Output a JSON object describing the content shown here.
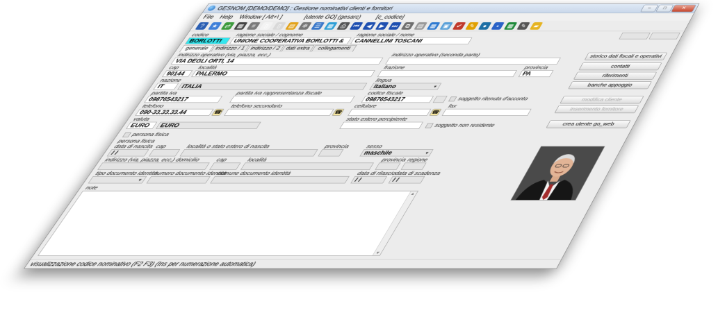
{
  "window": {
    "title": "GESNOM [DEMO/DEMO] : Gestione nominativi clienti e fornitori",
    "minimize_label": "–",
    "maximize_label": "□",
    "close_label": "✕"
  },
  "menu": {
    "file": "File",
    "help": "Help",
    "window": "Window [ Alt+\\ ]",
    "user": "[utente GO] (gesarc)",
    "field": "[c_codice]"
  },
  "toolbar": {
    "icons": [
      "help-icon",
      "star-icon",
      "export-icon",
      "calculator-icon",
      "notes-icon",
      "document-icon",
      "new-page-icon",
      "print-folder-icon",
      "gear-icon",
      "list-icon",
      "calendar-icon",
      "printer-icon",
      "first-record-icon",
      "prev-record-icon",
      "next-record-icon",
      "last-record-icon",
      "copy-icon",
      "notepad-icon",
      "calculator2-icon",
      "image-icon",
      "check-icon",
      "tools-icon",
      "globe-icon",
      "save-icon",
      "export-excel-icon",
      "edit-icon",
      "folder-icon"
    ],
    "colors": [
      "#2b5fb3",
      "#3e7fd9",
      "#3d9a3d",
      "#444444",
      "#7a7a7a",
      "#f3f3f3",
      "#d9d9d9",
      "#e2a21b",
      "#777777",
      "#3a78c9",
      "#2f9fd6",
      "#555555",
      "#1e4fb0",
      "#1e4fb0",
      "#1e4fb0",
      "#1e4fb0",
      "#6e6e6e",
      "#9a9a9a",
      "#2f7ad0",
      "#5aa0d8",
      "#c0392b",
      "#e0a000",
      "#1d6fa5",
      "#2962c7",
      "#1f8a3b",
      "#555555",
      "#e6b422"
    ]
  },
  "header": {
    "codice_label": "codice",
    "codice_value": "BORLOTTI",
    "ragione_cognome_label": "ragione sociale / cognome",
    "ragione_cognome_value": "UNIONE COOPERATIVA BORLOTTI &",
    "ragione_nome_label": "ragione sociale / nome",
    "ragione_nome_value": "CANNELLINI TOSCANI"
  },
  "tabs": [
    "generale",
    "indirizzo / 1",
    "indirizzo / 2",
    "dati extra",
    "collegamenti"
  ],
  "form": {
    "indirizzo_operativo_label": "indirizzo operativo (via, piazza, ecc.)",
    "indirizzo_operativo_value": "VIA DEGLI ORTI, 14",
    "indirizzo_seconda_label": "indirizzo operativo (seconda parte)",
    "indirizzo_seconda_value": "",
    "cap_label": "cap",
    "cap_value": "90144",
    "localita_label": "località",
    "localita_value": "PALERMO",
    "frazione_label": "frazione",
    "frazione_value": "",
    "provincia_label": "provincia",
    "provincia_value": "PA",
    "nazione_label": "nazione",
    "nazione_code": "IT",
    "nazione_value": "ITALIA",
    "lingua_label": "lingua",
    "lingua_value": "italiano",
    "partita_iva_label": "partita iva",
    "partita_iva_value": "09876543217",
    "piva_rappr_label": "partita iva rappresentanza fiscale",
    "piva_rappr_value": "",
    "codice_fiscale_label": "codice fiscale",
    "codice_fiscale_value": "09876543217",
    "ritenuta_label": "soggetto ritenuta d'acconto",
    "telefono_label": "telefono",
    "telefono_value": "090-33.33.33.44",
    "telefono2_label": "telefono secondario",
    "telefono2_value": "",
    "cellulare_label": "cellulare",
    "cellulare_value": "",
    "fax_label": "fax",
    "fax_value": "",
    "valuta_label": "valuta",
    "valuta_code": "EURO",
    "valuta_value": "EURO",
    "stato_estero_label": "stato estero percipiente",
    "stato_estero_value": "",
    "non_residente_label": "soggetto non residente",
    "persona_fisica_label": "persona fisica",
    "persona_fisica_title": "persona fisica",
    "data_nascita_label": "data di nascita",
    "data_nascita_value": "/ /",
    "cap_nascita_label": "cap",
    "localita_nascita_label": "località o stato estero di nascita",
    "provincia_nascita_label": "provincia",
    "sesso_label": "sesso",
    "sesso_value": "maschile",
    "domicilio_label": "indirizzo (via, piazza, ecc.) domicilio",
    "cap_dom_label": "cap",
    "localita_dom_label": "località",
    "provincia_dom_label": "provincia",
    "regione_label": "regione",
    "tipo_doc_label": "tipo documento identità",
    "numero_doc_label": "numero documento identità",
    "comune_doc_label": "comune documento identità",
    "data_rilascio_label": "data di rilascio",
    "data_rilascio_value": "/ /",
    "data_scadenza_label": "data di scadenza",
    "data_scadenza_value": "/ /",
    "note_label": "note"
  },
  "side_buttons": {
    "storico": "storico dati fiscali e operativi",
    "contatti": "contatti",
    "riferimenti": "riferimenti",
    "banche": "banche appoggio",
    "modifica": "modifica cliente",
    "inserimento": "inserimento fornitore",
    "crea_utente": "crea utente go_web"
  },
  "status": {
    "text": "visualizzazione codice nominativo (F2 F3) (Ins per numerazione automatica)"
  }
}
